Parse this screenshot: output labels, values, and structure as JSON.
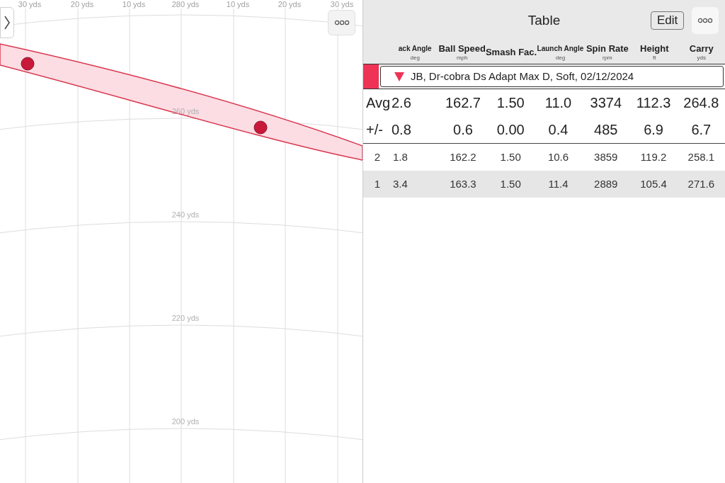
{
  "chart": {
    "lateral_labels": [
      "30 yds",
      "20 yds",
      "10 yds",
      "280 yds",
      "10 yds",
      "20 yds",
      "30 yds"
    ],
    "distance_labels": [
      "260 yds",
      "240 yds",
      "220 yds",
      "200 yds"
    ]
  },
  "panel": {
    "title": "Table",
    "edit_button": "Edit",
    "columns": [
      {
        "name": "ack Angle",
        "unit": "deg",
        "small": true
      },
      {
        "name": "Ball Speed",
        "unit": "mph",
        "small": false
      },
      {
        "name": "Smash Fac.",
        "small": false
      },
      {
        "name": "Launch Angle",
        "unit": "deg",
        "small": true
      },
      {
        "name": "Spin Rate",
        "unit": "rpm",
        "small": false
      },
      {
        "name": "Height",
        "unit": "ft",
        "small": false
      },
      {
        "name": "Carry",
        "unit": "yds",
        "small": false
      }
    ],
    "group": {
      "label": "JB, Dr-cobra Ds Adapt Max D, Soft, 02/12/2024",
      "color": "#ee3355",
      "expanded": true
    },
    "summary": [
      {
        "label": "Avg",
        "values": [
          "2.6",
          "162.7",
          "1.50",
          "11.0",
          "3374",
          "112.3",
          "264.8"
        ]
      },
      {
        "label": "+/-",
        "values": [
          "0.8",
          "0.6",
          "0.00",
          "0.4",
          "485",
          "6.9",
          "6.7"
        ]
      }
    ],
    "rows": [
      {
        "label": "2",
        "values": [
          "1.8",
          "162.2",
          "1.50",
          "10.6",
          "3859",
          "119.2",
          "258.1"
        ],
        "selected": false
      },
      {
        "label": "1",
        "values": [
          "3.4",
          "163.3",
          "1.50",
          "11.4",
          "2889",
          "105.4",
          "271.6"
        ],
        "selected": true
      }
    ]
  }
}
